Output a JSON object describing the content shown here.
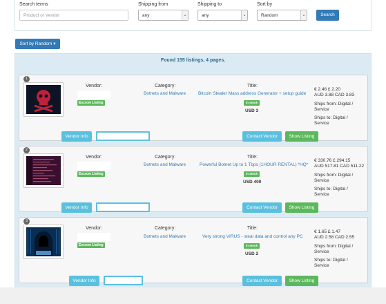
{
  "search": {
    "terms_label": "Search terms",
    "terms_placeholder": "Product or Vendor",
    "shipping_from_label": "Shipping from",
    "shipping_from_value": "any",
    "shipping_to_label": "Shipping to",
    "shipping_to_value": "any",
    "sort_label": "Sort by",
    "sort_value": "Random",
    "search_button": "Search"
  },
  "sort_button": "Sort by Random ▾",
  "found_text": "Found 155 listings, 4 pages.",
  "labels": {
    "vendor": "Vendor:",
    "category": "Category:",
    "title": "Title:",
    "escrow": "Escrow Listing",
    "in_stock": "In stock",
    "ships_from": "Ships from: Digital / Service",
    "ships_to": "Ships to: Digital / Service",
    "vendor_info": "Vendor Info",
    "contact_vendor": "Contact Vendor",
    "show_listing": "Show Listing"
  },
  "listings": [
    {
      "num": "1",
      "category": "Botnets and Malware",
      "title": "Bitcoin Stealer Mass address Generator + setup guide",
      "usd": "USD 3",
      "price_line1": "€ 2.46 £ 2.20",
      "price_line2": "AUD 3.88 CAD 3.83",
      "image": "skull-crossbones-red"
    },
    {
      "num": "2",
      "category": "Botnets and Malware",
      "title": "Powerful Botnet Up to 1 Tbps (1HOUR RENTAL) *HQ*",
      "usd": "USD 400",
      "price_line1": "€ 330.76 £ 294.15",
      "price_line2": "AUD 517.81 CAD 511.22",
      "image": "terminal-screen-purple"
    },
    {
      "num": "3",
      "category": "Botnets and Malware",
      "title": "Very strong VIRUS - steal data and control any PC",
      "usd": "USD 2",
      "price_line1": "€ 1.65 £ 1.47",
      "price_line2": "AUD 2.58 CAD 2.55",
      "image": "hooded-hacker-blue"
    }
  ],
  "colors": {
    "primary": "#337ab7",
    "info": "#5bc0de",
    "success": "#5cb85c",
    "panel": "#dcebf3"
  }
}
